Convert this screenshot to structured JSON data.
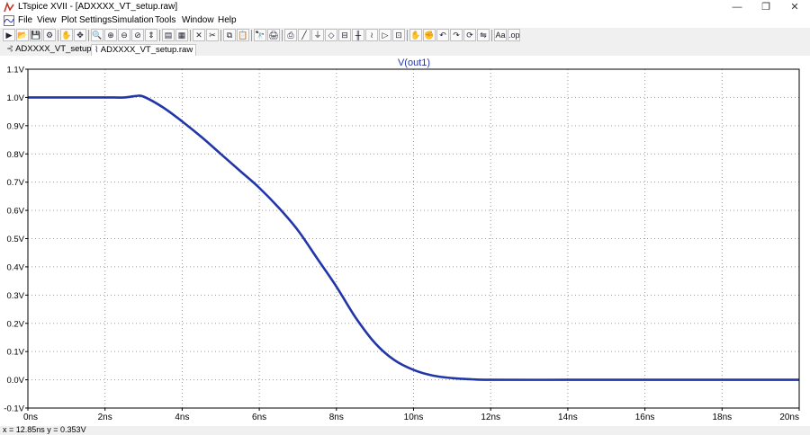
{
  "window": {
    "title": "LTspice XVII - [ADXXXX_VT_setup.raw]",
    "controls": [
      "—",
      "❐",
      "✕"
    ]
  },
  "menu": {
    "items": [
      "File",
      "View",
      "Plot Settings",
      "Simulation",
      "Tools",
      "Window",
      "Help"
    ]
  },
  "toolbar": {
    "icons": [
      "run-icon",
      "open-icon",
      "save-icon",
      "control-panel-icon",
      "halt-icon",
      "pan-icon",
      "zoom-in-icon",
      "zoom-full-icon",
      "zoom-out-icon",
      "zoom-fit-icon",
      "autorange-icon",
      "tile-icon",
      "cascade-icon",
      "delete-icon",
      "cut-icon",
      "copy-icon",
      "paste-icon",
      "find-icon",
      "print-icon",
      "print-preview-icon",
      "wire-icon",
      "ground-icon",
      "label-icon",
      "resistor-icon",
      "capacitor-icon",
      "inductor-icon",
      "diode-icon",
      "component-icon",
      "move-icon",
      "drag-icon",
      "undo-icon",
      "redo-icon",
      "rotate-icon",
      "mirror-icon",
      "text-icon",
      "spice-directive-icon"
    ],
    "glyphs": [
      "▶",
      "📂",
      "💾",
      "⚙",
      "✋",
      "✥",
      "🔍",
      "⊕",
      "⊖",
      "⊘",
      "⇕",
      "▤",
      "▦",
      "✕",
      "✂",
      "⧉",
      "📋",
      "🔭",
      "🖨",
      "⎙",
      "╱",
      "⏚",
      "◇",
      "⊟",
      "╫",
      "≀",
      "▷",
      "⊡",
      "✋",
      "✊",
      "↶",
      "↷",
      "⟳",
      "⇋",
      "Aa",
      ".op"
    ]
  },
  "tabs": [
    {
      "label": "ADXXXX_VT_setup.asc",
      "active": false
    },
    {
      "label": "ADXXXX_VT_setup.raw",
      "active": true
    }
  ],
  "status": {
    "text": "x = 12.85ns   y = 0.353V"
  },
  "chart_data": {
    "type": "line",
    "title": "V(out1)",
    "xlabel": "",
    "ylabel": "",
    "xlim": [
      0,
      20
    ],
    "ylim": [
      -0.1,
      1.1
    ],
    "x_ticks": [
      "0ns",
      "2ns",
      "4ns",
      "6ns",
      "8ns",
      "10ns",
      "12ns",
      "14ns",
      "16ns",
      "18ns",
      "20ns"
    ],
    "y_ticks": [
      "-0.1V",
      "0.0V",
      "0.1V",
      "0.2V",
      "0.3V",
      "0.4V",
      "0.5V",
      "0.6V",
      "0.7V",
      "0.8V",
      "0.9V",
      "1.0V",
      "1.1V"
    ],
    "grid": true,
    "colors": {
      "trace": "#2236a8",
      "axis": "#000000",
      "grid": "#9a9a9a",
      "title": "#2236a8"
    },
    "series": [
      {
        "name": "V(out1)",
        "x": [
          0,
          1,
          2,
          2.5,
          2.8,
          3.0,
          3.5,
          4.0,
          4.5,
          5.0,
          5.5,
          6.0,
          6.5,
          7.0,
          7.5,
          8.0,
          8.5,
          9.0,
          9.5,
          10.0,
          10.5,
          11.0,
          11.5,
          12.0,
          14.0,
          16.0,
          18.0,
          20.0
        ],
        "y": [
          1.0,
          1.0,
          1.0,
          1.0,
          1.005,
          1.003,
          0.965,
          0.915,
          0.86,
          0.8,
          0.74,
          0.68,
          0.61,
          0.53,
          0.43,
          0.33,
          0.22,
          0.13,
          0.07,
          0.035,
          0.015,
          0.006,
          0.002,
          0.0,
          0.0,
          0.0,
          0.0,
          0.0
        ]
      }
    ]
  }
}
